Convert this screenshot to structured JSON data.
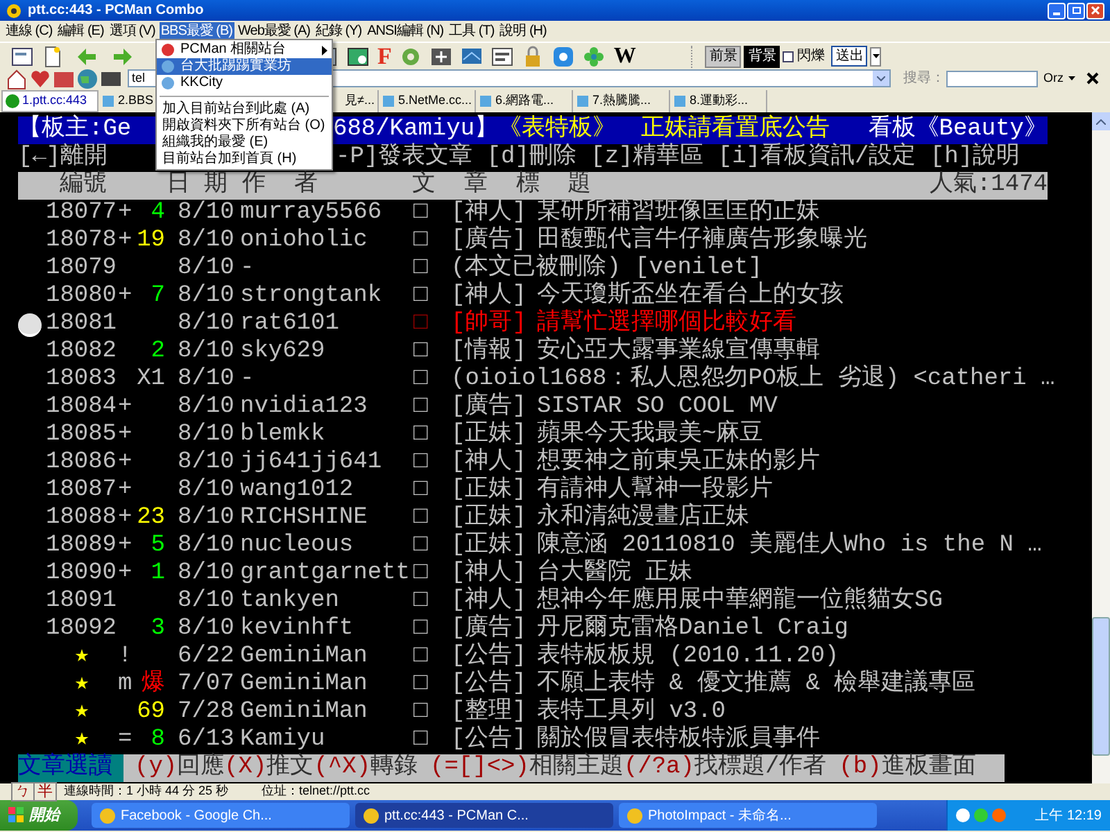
{
  "window": {
    "title": "ptt.cc:443 - PCMan Combo"
  },
  "menu_bar": [
    {
      "label": "連線 (C)",
      "selected": false
    },
    {
      "label": "編輯 (E)",
      "selected": false
    },
    {
      "label": "選項 (V)",
      "selected": false
    },
    {
      "label": "BBS最愛 (B)",
      "selected": true
    },
    {
      "label": "Web最愛 (A)",
      "selected": false
    },
    {
      "label": "紀錄 (Y)",
      "selected": false
    },
    {
      "label": "ANSI編輯 (N)",
      "selected": false
    },
    {
      "label": "工具 (T)",
      "selected": false
    },
    {
      "label": "說明 (H)",
      "selected": false
    }
  ],
  "bbs_menu": {
    "sites": [
      {
        "label": "PCMan 相關站台",
        "submenu": true,
        "selected": false
      },
      {
        "label": "台大批踢踢實業坊",
        "submenu": false,
        "selected": true
      },
      {
        "label": "KKCity",
        "submenu": false,
        "selected": false
      }
    ],
    "actions": [
      {
        "label": "加入目前站台到此處 (A)",
        "selected": false
      },
      {
        "label": "開啟資料夾下所有站台 (O)",
        "selected": false
      },
      {
        "label": "組織我的最愛 (E)",
        "selected": false
      },
      {
        "label": "目前站台加到首頁 (H)",
        "selected": false
      }
    ]
  },
  "toolbar": {
    "font_button": "F",
    "wiki_button": "W",
    "color_buttons": [
      {
        "label": "前景",
        "selected": false
      },
      {
        "label": "背景",
        "selected": true
      }
    ],
    "blink": {
      "label": "閃爍",
      "checked": false
    },
    "send_button": "送出"
  },
  "address_bar": {
    "value": "tel",
    "search_label": "搜尋：",
    "emoticon": "Orz"
  },
  "tabs": [
    {
      "label": "1.ptt.cc:443",
      "selected": true
    },
    {
      "label": "2.BBS",
      "selected": false
    },
    {
      "label": "見≠...",
      "selected": false
    },
    {
      "label": "5.NetMe.cc...",
      "selected": false
    },
    {
      "label": "6.網路電...",
      "selected": false
    },
    {
      "label": "7.熱騰騰...",
      "selected": false
    },
    {
      "label": "8.運動彩...",
      "selected": false
    }
  ],
  "title_symbol": "□",
  "board_header": {
    "moderator": "【板主:Ge",
    "moderator_rest": "688/Kamiyu】",
    "board": "《表特板》",
    "notice": "正妹請看置底公告",
    "board_name": "看板《Beauty》"
  },
  "help_line": {
    "left": "[←]離開",
    "right": "-P]發表文章 [d]刪除 [z]精華區 [i]看板資訊/設定 [h]說明"
  },
  "columns": {
    "number": "編號",
    "date_author": "日 期 作  者",
    "title": "文  章  標  題",
    "popularity": "人氣:1474"
  },
  "rows": [
    {
      "kind": "article",
      "number": "18077",
      "mark": "+",
      "count": {
        "text": "4",
        "color": "#00ff00"
      },
      "date": "8/10",
      "author": "murray5566",
      "tag": "[神人]",
      "title": "某研所補習班像匡匡的正妹",
      "color": "#c0c0c0",
      "selected": false
    },
    {
      "kind": "article",
      "number": "18078",
      "mark": "+",
      "count": {
        "text": "19",
        "color": "#ffff00"
      },
      "date": "8/10",
      "author": "onioholic",
      "tag": "[廣告]",
      "title": "田馥甄代言牛仔褲廣告形象曝光",
      "color": "#c0c0c0",
      "selected": false
    },
    {
      "kind": "article",
      "number": "18079",
      "date": "8/10",
      "author": "-",
      "title": "(本文已被刪除) [venilet]",
      "color": "#c0c0c0",
      "selected": false
    },
    {
      "kind": "article",
      "number": "18080",
      "mark": "+",
      "count": {
        "text": "7",
        "color": "#00ff00"
      },
      "date": "8/10",
      "author": "strongtank",
      "tag": "[神人]",
      "title": "今天瓊斯盃坐在看台上的女孩",
      "color": "#c0c0c0",
      "selected": false
    },
    {
      "kind": "article",
      "number": "18081",
      "date": "8/10",
      "author": "rat6101",
      "tag": "[帥哥]",
      "title": "請幫忙選擇哪個比較好看",
      "color": "#ff0000",
      "selected": true
    },
    {
      "kind": "article",
      "number": "18082",
      "count": {
        "text": "2",
        "color": "#00ff00"
      },
      "date": "8/10",
      "author": "sky629",
      "tag": "[情報]",
      "title": "安心亞大露事業線宣傳專輯",
      "color": "#c0c0c0",
      "selected": false
    },
    {
      "kind": "article",
      "number": "18083",
      "count": {
        "text": "X1",
        "color": "#c0c0c0"
      },
      "date": "8/10",
      "author": "-",
      "title": "(oioiol1688：私人恩怨勿PO板上 劣退) <catheri …",
      "color": "#c0c0c0",
      "selected": false
    },
    {
      "kind": "article",
      "number": "18084",
      "mark": "+",
      "date": "8/10",
      "author": "nvidia123",
      "tag": "[廣告]",
      "title": "SISTAR SO COOL MV",
      "color": "#c0c0c0",
      "selected": false
    },
    {
      "kind": "article",
      "number": "18085",
      "mark": "+",
      "date": "8/10",
      "author": "blemkk",
      "tag": "[正妹]",
      "title": "蘋果今天我最美~麻豆",
      "color": "#c0c0c0",
      "selected": false
    },
    {
      "kind": "article",
      "number": "18086",
      "mark": "+",
      "date": "8/10",
      "author": "jj641jj641",
      "tag": "[神人]",
      "title": "想要神之前東吳正妹的影片",
      "color": "#c0c0c0",
      "selected": false
    },
    {
      "kind": "article",
      "number": "18087",
      "mark": "+",
      "date": "8/10",
      "author": "wang1012",
      "tag": "[正妹]",
      "title": "有請神人幫神一段影片",
      "color": "#c0c0c0",
      "selected": false
    },
    {
      "kind": "article",
      "number": "18088",
      "mark": "+",
      "count": {
        "text": "23",
        "color": "#ffff00"
      },
      "date": "8/10",
      "author": "RICHSHINE",
      "tag": "[正妹]",
      "title": "永和清純漫畫店正妹",
      "color": "#c0c0c0",
      "selected": false
    },
    {
      "kind": "article",
      "number": "18089",
      "mark": "+",
      "count": {
        "text": "5",
        "color": "#00ff00"
      },
      "date": "8/10",
      "author": "nucleous",
      "tag": "[正妹]",
      "title": "陳意涵 20110810 美麗佳人Who is the N …",
      "color": "#c0c0c0",
      "selected": false
    },
    {
      "kind": "article",
      "number": "18090",
      "mark": "+",
      "count": {
        "text": "1",
        "color": "#00ff00"
      },
      "date": "8/10",
      "author": "grantgarnett",
      "tag": "[神人]",
      "title": "台大醫院 正妹",
      "color": "#c0c0c0",
      "selected": false
    },
    {
      "kind": "article",
      "number": "18091",
      "date": "8/10",
      "author": "tankyen",
      "tag": "[神人]",
      "title": "想神今年應用展中華網龍一位熊貓女SG",
      "color": "#c0c0c0",
      "selected": false
    },
    {
      "kind": "article",
      "number": "18092",
      "count": {
        "text": "3",
        "color": "#00ff00"
      },
      "date": "8/10",
      "author": "kevinhft",
      "tag": "[廣告]",
      "title": "丹尼爾克雷格Daniel Craig",
      "color": "#c0c0c0",
      "selected": false
    },
    {
      "kind": "pinned",
      "number": "★",
      "mark": "!",
      "date": "6/22",
      "author": "GeminiMan",
      "tag": "[公告]",
      "title": "表特板板規 (2010.11.20)",
      "color": "#c0c0c0",
      "selected": false
    },
    {
      "kind": "pinned",
      "number": "★",
      "mark": "m",
      "count": {
        "text": "爆",
        "color": "#ff0000"
      },
      "date": "7/07",
      "author": "GeminiMan",
      "tag": "[公告]",
      "title": "不願上表特 & 優文推薦 & 檢舉建議專區",
      "color": "#c0c0c0",
      "selected": false
    },
    {
      "kind": "pinned",
      "number": "★",
      "count": {
        "text": "69",
        "color": "#ffff00"
      },
      "date": "7/28",
      "author": "GeminiMan",
      "tag": "[整理]",
      "title": "表特工具列 v3.0",
      "color": "#c0c0c0",
      "selected": false
    },
    {
      "kind": "pinned",
      "number": "★",
      "mark": "=",
      "count": {
        "text": "8",
        "color": "#00ff00"
      },
      "date": "6/13",
      "author": "Kamiyu",
      "tag": "[公告]",
      "title": "關於假冒表特板特派員事件",
      "color": "#c0c0c0",
      "selected": false
    }
  ],
  "footer": {
    "mode": "文章選讀",
    "hints": [
      {
        "key": "(y)",
        "label": "回應"
      },
      {
        "key": "(X)",
        "label": "推文"
      },
      {
        "key": "(^X)",
        "label": "轉錄"
      },
      {
        "key": "(=[]<>)",
        "label": "相關主題"
      },
      {
        "key": "(/?a)",
        "label": "找標題/作者"
      },
      {
        "key": "(b)",
        "label": "進板畫面"
      }
    ]
  },
  "ime": {
    "symbol": "ㄅ",
    "width": "半"
  },
  "status_bar": {
    "connection_time": "連線時間：1 小時 44 分 25 秒",
    "address": "位址：telnet://ptt.cc"
  },
  "taskbar": {
    "start": "開始",
    "tasks": [
      {
        "label": "Facebook - Google Ch...",
        "selected": false
      },
      {
        "label": "ptt.cc:443 - PCMan C...",
        "selected": true
      },
      {
        "label": "PhotoImpact - 未命名...",
        "selected": false
      }
    ],
    "clock": "上午 12:19"
  }
}
